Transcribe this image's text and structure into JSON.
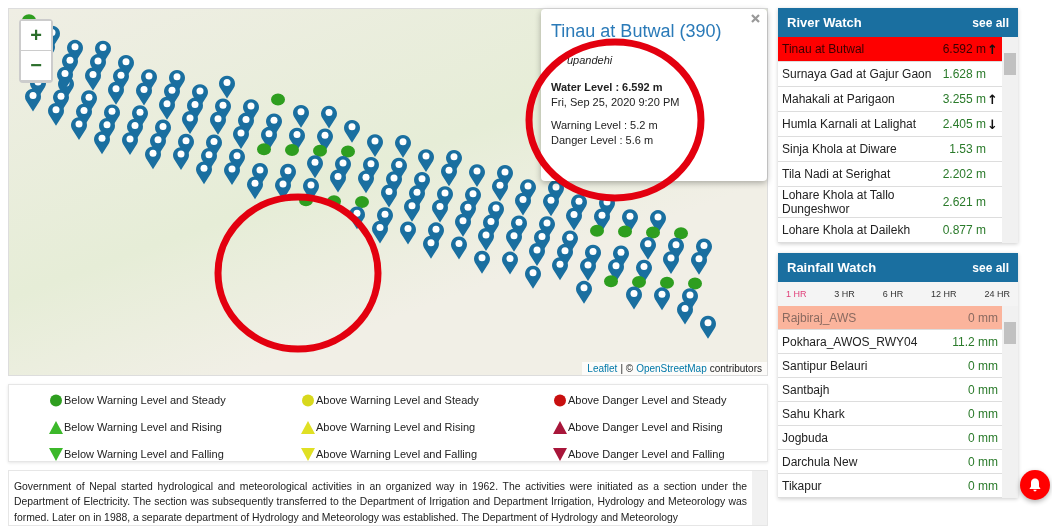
{
  "map": {
    "zoom_in": "+",
    "zoom_out": "−",
    "attribution": {
      "link": "Leaflet",
      "separator": "| ©",
      "osm": "OpenStreetMap",
      "suffix": "contributors"
    }
  },
  "popup": {
    "title": "Tinau at Butwal (390)",
    "district": "upandehi",
    "water_level": "Water Level : 6.592 m",
    "datetime": "Fri, Sep 25, 2020 9:20 PM",
    "warning": "Warning Level : 5.2 m",
    "danger": "Danger Level : 5.6 m"
  },
  "legend": [
    {
      "kind": "circle",
      "color": "#2e9e1f",
      "label": "Below Warning Level and Steady"
    },
    {
      "kind": "circle",
      "color": "#d8d81c",
      "label": "Above Warning Level and Steady"
    },
    {
      "kind": "circle",
      "color": "#c80f0f",
      "label": "Above Danger Level and Steady"
    },
    {
      "kind": "up",
      "color": "#3cb82a",
      "label": "Below Warning Level and Rising"
    },
    {
      "kind": "up",
      "color": "#e0e024",
      "label": "Above Warning Level and Rising"
    },
    {
      "kind": "up",
      "color": "#a8163a",
      "label": "Above Danger Level and Rising"
    },
    {
      "kind": "down",
      "color": "#3cb82a",
      "label": "Below Warning Level and Falling"
    },
    {
      "kind": "down",
      "color": "#e0e024",
      "label": "Above Warning Level and Falling"
    },
    {
      "kind": "down",
      "color": "#a8163a",
      "label": "Above Danger Level and Falling"
    }
  ],
  "about": {
    "text": "Government of Nepal started hydrological and meteorological activities in an organized way in 1962. The activities were initiated as a section under the Department of Electricity. The section was subsequently transferred to the Department of Irrigation and Department Irrigation, Hydrology and Meteorology was formed. Later on in 1988, a separate department of Hydrology and Meteorology was established. The Department of Hydrology and Meteorology"
  },
  "river_watch": {
    "title": "River Watch",
    "see_all": "see all",
    "rows": [
      {
        "name": "Tinau at Butwal",
        "value": "6.592 m",
        "trend": "↑",
        "highlighted": true
      },
      {
        "name": "Surnaya Gad at Gajur Gaon",
        "value": "1.628 m",
        "highlighted": false
      },
      {
        "name": "Mahakali at Parigaon",
        "value": "3.255 m",
        "trend": "↑",
        "highlighted": false
      },
      {
        "name": "Humla Karnali at Lalighat",
        "value": "2.405 m",
        "trend": "↓",
        "highlighted": false
      },
      {
        "name": "Sinja Khola at Diware",
        "value": "1.53 m",
        "highlighted": false
      },
      {
        "name": "Tila Nadi at Serighat",
        "value": "2.202 m",
        "highlighted": false
      },
      {
        "name": "Lohare Khola at Tallo Dungeshwor",
        "value": "2.621 m",
        "highlighted": false
      },
      {
        "name": "Lohare Khola at Dailekh",
        "value": "0.877 m",
        "highlighted": false
      }
    ]
  },
  "rainfall_watch": {
    "title": "Rainfall Watch",
    "see_all": "see all",
    "tabs": [
      {
        "label": "1 HR",
        "selected": true
      },
      {
        "label": "3 HR",
        "selected": false
      },
      {
        "label": "6 HR",
        "selected": false
      },
      {
        "label": "12 HR",
        "selected": false
      },
      {
        "label": "24 HR",
        "selected": false
      }
    ],
    "rows": [
      {
        "name": "Rajbiraj_AWS",
        "value": "0 mm",
        "highlighted": true
      },
      {
        "name": "Pokhara_AWOS_RWY04",
        "value": "11.2 mm",
        "highlighted": false
      },
      {
        "name": "Santipur Belauri",
        "value": "0 mm",
        "highlighted": false
      },
      {
        "name": "Santbajh",
        "value": "0 mm",
        "highlighted": false
      },
      {
        "name": "Sahu Khark",
        "value": "0 mm",
        "highlighted": false
      },
      {
        "name": "Jogbuda",
        "value": "0 mm",
        "highlighted": false
      },
      {
        "name": "Darchula New",
        "value": "0 mm",
        "highlighted": false
      },
      {
        "name": "Tikapur",
        "value": "0 mm",
        "highlighted": false
      }
    ]
  }
}
